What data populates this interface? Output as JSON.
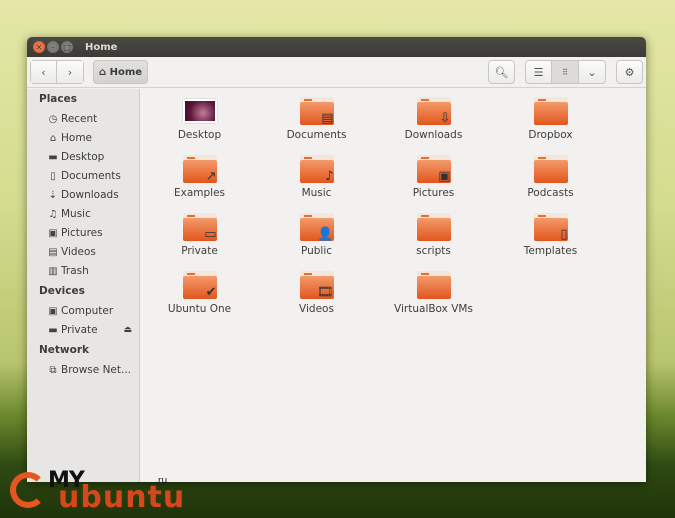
{
  "window": {
    "title": "Home"
  },
  "toolbar": {
    "back_icon": "chevron-left",
    "forward_icon": "chevron-right",
    "breadcrumb": "Home",
    "breadcrumb_icon": "home-icon",
    "search_icon": "search",
    "list_icon": "list",
    "grid_icon": "grid",
    "dropdown_icon": "chevron-down",
    "settings_icon": "gear"
  },
  "sidebar": {
    "places_header": "Places",
    "places": [
      {
        "label": "Recent",
        "icon": "◷"
      },
      {
        "label": "Home",
        "icon": "⌂"
      },
      {
        "label": "Desktop",
        "icon": "▬"
      },
      {
        "label": "Documents",
        "icon": "▯"
      },
      {
        "label": "Downloads",
        "icon": "⇣"
      },
      {
        "label": "Music",
        "icon": "♫"
      },
      {
        "label": "Pictures",
        "icon": "▣"
      },
      {
        "label": "Videos",
        "icon": "▤"
      },
      {
        "label": "Trash",
        "icon": "▥"
      }
    ],
    "devices_header": "Devices",
    "devices": [
      {
        "label": "Computer",
        "icon": "▣"
      },
      {
        "label": "Private",
        "icon": "▬"
      }
    ],
    "eject_icon": "⏏",
    "network_header": "Network",
    "network": [
      {
        "label": "Browse Net...",
        "icon": "⧉"
      }
    ]
  },
  "files": [
    {
      "label": "Desktop",
      "type": "desktop"
    },
    {
      "label": "Documents",
      "emblem": "▤"
    },
    {
      "label": "Downloads",
      "emblem": "⇩"
    },
    {
      "label": "Dropbox",
      "emblem": ""
    },
    {
      "label": "Examples",
      "emblem": "↗"
    },
    {
      "label": "Music",
      "emblem": "♪"
    },
    {
      "label": "Pictures",
      "emblem": "▣"
    },
    {
      "label": "Podcasts",
      "emblem": ""
    },
    {
      "label": "Private",
      "emblem": "▭"
    },
    {
      "label": "Public",
      "emblem": "👤"
    },
    {
      "label": "scripts",
      "emblem": ""
    },
    {
      "label": "Templates",
      "emblem": "▯"
    },
    {
      "label": "Ubuntu One",
      "emblem": "✔"
    },
    {
      "label": "Videos",
      "emblem": "🎞"
    },
    {
      "label": "VirtualBox VMs",
      "emblem": ""
    }
  ],
  "watermark": {
    "my": "MY",
    "ubuntu": "ubuntu",
    "ru": ".ru"
  },
  "colors": {
    "accent": "#e2551d",
    "titlebar": "#3b3a36"
  }
}
